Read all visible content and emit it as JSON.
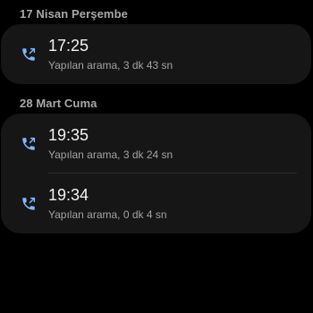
{
  "colors": {
    "background": "#000000",
    "card": "#161616",
    "header_text": "#a9a9a9",
    "primary_text": "#f2f2f2",
    "secondary_text": "#a3a3a3",
    "icon": "#7fb8ff"
  },
  "call_log": {
    "groups": [
      {
        "date": "17 Nisan Perşembe",
        "calls": [
          {
            "icon": "outgoing-call-icon",
            "time": "17:25",
            "detail": "Yapılan arama, 3 dk 43 sn"
          }
        ]
      },
      {
        "date": "28 Mart Cuma",
        "calls": [
          {
            "icon": "outgoing-call-icon",
            "time": "19:35",
            "detail": "Yapılan arama, 3 dk 24 sn"
          },
          {
            "icon": "outgoing-call-icon",
            "time": "19:34",
            "detail": "Yapılan arama, 0 dk 4 sn"
          }
        ]
      }
    ]
  }
}
